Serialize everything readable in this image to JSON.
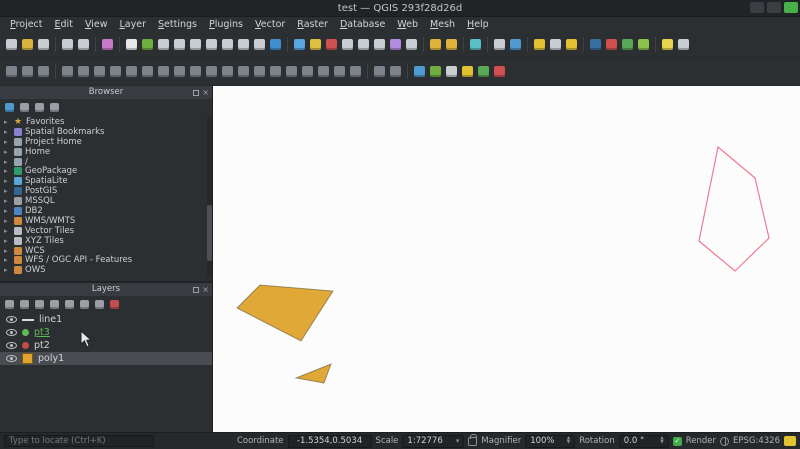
{
  "window": {
    "title": "test — QGIS 293f28d26d"
  },
  "menubar": {
    "items": [
      "Project",
      "Edit",
      "View",
      "Layer",
      "Settings",
      "Plugins",
      "Vector",
      "Raster",
      "Database",
      "Web",
      "Mesh",
      "Help"
    ]
  },
  "toolbars": {
    "row1": [
      {
        "name": "new-project-icon",
        "color": "#c9ced2"
      },
      {
        "name": "open-project-icon",
        "color": "#d9b23a"
      },
      {
        "name": "save-project-icon",
        "color": "#c9ced2"
      },
      {
        "sep": true
      },
      {
        "name": "new-print-layout-icon",
        "color": "#c9ced2"
      },
      {
        "name": "layout-manager-icon",
        "color": "#c9ced2"
      },
      {
        "sep": true
      },
      {
        "name": "style-manager-icon",
        "color": "#c879c8"
      },
      {
        "sep": true
      },
      {
        "name": "pan-map-icon",
        "color": "#e8e8e8"
      },
      {
        "name": "pan-to-selection-icon",
        "color": "#6fae3f"
      },
      {
        "name": "zoom-in-icon",
        "color": "#c9ced2"
      },
      {
        "name": "zoom-out-icon",
        "color": "#c9ced2"
      },
      {
        "name": "zoom-full-icon",
        "color": "#c9ced2"
      },
      {
        "name": "zoom-to-selection-icon",
        "color": "#c9ced2"
      },
      {
        "name": "zoom-to-layer-icon",
        "color": "#c9ced2"
      },
      {
        "name": "zoom-last-icon",
        "color": "#c9ced2"
      },
      {
        "name": "zoom-next-icon",
        "color": "#c9ced2"
      },
      {
        "name": "map-refresh-icon",
        "color": "#3f8fd0"
      },
      {
        "sep": true
      },
      {
        "name": "identify-features-icon",
        "color": "#5aa7e0"
      },
      {
        "name": "select-features-icon",
        "color": "#e0c040"
      },
      {
        "name": "deselect-features-icon",
        "color": "#d05050"
      },
      {
        "name": "select-by-expression-icon",
        "color": "#c9ced2"
      },
      {
        "name": "attribute-table-icon",
        "color": "#c9ced2"
      },
      {
        "name": "field-calculator-icon",
        "color": "#c9ced2"
      },
      {
        "name": "measure-line-icon",
        "color": "#b08be0"
      },
      {
        "name": "statistical-summary-icon",
        "color": "#c9ced2"
      },
      {
        "sep": true
      },
      {
        "name": "new-bookmark-icon",
        "color": "#e0b43c"
      },
      {
        "name": "show-bookmarks-icon",
        "color": "#e0b43c"
      },
      {
        "sep": true
      },
      {
        "name": "temporal-controller-icon",
        "color": "#58c0c8"
      },
      {
        "sep": true
      },
      {
        "name": "new-3d-map-icon",
        "color": "#c9ced2"
      },
      {
        "name": "data-source-manager-icon",
        "color": "#4f9ad0"
      },
      {
        "sep": true
      },
      {
        "name": "toggle-editing-icon",
        "color": "#e2c231"
      },
      {
        "name": "save-layer-edits-icon",
        "color": "#c9ced2"
      },
      {
        "name": "current-edits-icon",
        "color": "#e2c231"
      },
      {
        "sep": true
      },
      {
        "name": "python-console-icon",
        "color": "#3670a0"
      },
      {
        "name": "processing-toolbox-icon",
        "color": "#d05050"
      },
      {
        "name": "metasearch-icon",
        "color": "#58a858"
      },
      {
        "name": "osm-place-search-icon",
        "color": "#8bc34a"
      },
      {
        "sep": true
      },
      {
        "name": "help-icon",
        "color": "#e8d44d"
      },
      {
        "name": "whats-this-icon",
        "color": "#c9ced2"
      }
    ],
    "row2": [
      {
        "name": "enable-advanced-digitizing-icon",
        "color": "#7d838a"
      },
      {
        "name": "digitize-with-segment-icon",
        "color": "#7d838a"
      },
      {
        "name": "stream-digitizing-icon",
        "color": "#7d838a"
      },
      {
        "sep": true
      },
      {
        "name": "move-feature-icon",
        "color": "#7d838a"
      },
      {
        "name": "copy-move-feature-icon",
        "color": "#7d838a"
      },
      {
        "name": "rotate-feature-icon",
        "color": "#7d838a"
      },
      {
        "name": "simplify-feature-icon",
        "color": "#7d838a"
      },
      {
        "name": "add-ring-icon",
        "color": "#7d838a"
      },
      {
        "name": "add-part-icon",
        "color": "#7d838a"
      },
      {
        "name": "fill-ring-icon",
        "color": "#7d838a"
      },
      {
        "name": "delete-ring-icon",
        "color": "#7d838a"
      },
      {
        "name": "delete-part-icon",
        "color": "#7d838a"
      },
      {
        "name": "offset-curve-icon",
        "color": "#7d838a"
      },
      {
        "name": "reshape-features-icon",
        "color": "#7d838a"
      },
      {
        "name": "split-parts-icon",
        "color": "#7d838a"
      },
      {
        "name": "split-features-icon",
        "color": "#7d838a"
      },
      {
        "name": "merge-features-icon",
        "color": "#7d838a"
      },
      {
        "name": "merge-attributes-icon",
        "color": "#7d838a"
      },
      {
        "name": "modify-attributes-icon",
        "color": "#7d838a"
      },
      {
        "name": "rotate-point-symbols-icon",
        "color": "#7d838a"
      },
      {
        "name": "offset-point-symbol-icon",
        "color": "#7d838a"
      },
      {
        "name": "trim-extend-icon",
        "color": "#7d838a"
      },
      {
        "sep": true
      },
      {
        "name": "vertex-tool-all-layers-icon",
        "color": "#7d838a"
      },
      {
        "name": "vertex-tool-active-layer-icon",
        "color": "#7d838a"
      },
      {
        "sep": true
      },
      {
        "name": "processing-icon",
        "color": "#4f9ad0"
      },
      {
        "name": "grass-tools-icon",
        "color": "#6fae3f"
      },
      {
        "name": "raster-calculator-icon",
        "color": "#c9ced2"
      },
      {
        "name": "georeferencer-icon",
        "color": "#e2c231"
      },
      {
        "name": "mesh-calculator-icon",
        "color": "#58a858"
      },
      {
        "name": "plugin-tool-icon",
        "color": "#d05050"
      }
    ]
  },
  "browser": {
    "title": "Browser",
    "toolbar": [
      {
        "name": "refresh-browser-icon",
        "color": "#4f9ad0"
      },
      {
        "name": "filter-browser-icon",
        "color": "#9aa0a5"
      },
      {
        "name": "collapse-all-icon",
        "color": "#9aa0a5"
      },
      {
        "name": "enable-properties-icon",
        "color": "#9aa0a5"
      }
    ],
    "items": [
      {
        "label": "Favorites",
        "icon": "favorites-icon",
        "glyph": "★",
        "color": "#d4a73c"
      },
      {
        "label": "Spatial Bookmarks",
        "icon": "spatial-bookmarks-icon",
        "color": "#8a7fd0"
      },
      {
        "label": "Project Home",
        "icon": "project-home-folder-icon",
        "color": "#97a3ad"
      },
      {
        "label": "Home",
        "icon": "home-folder-icon",
        "color": "#97a3ad"
      },
      {
        "label": "/",
        "icon": "root-folder-icon",
        "color": "#97a3ad"
      },
      {
        "label": "GeoPackage",
        "icon": "geopackage-icon",
        "color": "#2e9c6b"
      },
      {
        "label": "SpatiaLite",
        "icon": "spatialite-icon",
        "color": "#55a8d8"
      },
      {
        "label": "PostGIS",
        "icon": "postgis-icon",
        "color": "#336791"
      },
      {
        "label": "MSSQL",
        "icon": "mssql-icon",
        "color": "#9aa0a5"
      },
      {
        "label": "DB2",
        "icon": "db2-icon",
        "color": "#4f84c4"
      },
      {
        "label": "WMS/WMTS",
        "icon": "wms-wmts-icon",
        "color": "#d0873e"
      },
      {
        "label": "Vector Tiles",
        "icon": "vector-tiles-icon",
        "color": "#b8bcc0"
      },
      {
        "label": "XYZ Tiles",
        "icon": "xyz-tiles-icon",
        "color": "#b8bcc0"
      },
      {
        "label": "WCS",
        "icon": "wcs-icon",
        "color": "#d0873e"
      },
      {
        "label": "WFS / OGC API - Features",
        "icon": "wfs-icon",
        "color": "#d0873e"
      },
      {
        "label": "OWS",
        "icon": "ows-icon",
        "color": "#d0873e"
      }
    ]
  },
  "layers": {
    "title": "Layers",
    "toolbar": [
      {
        "name": "open-layer-styling-icon",
        "color": "#9aa0a5"
      },
      {
        "name": "add-group-icon",
        "color": "#9aa0a5"
      },
      {
        "name": "manage-map-themes-icon",
        "color": "#9aa0a5"
      },
      {
        "name": "filter-legend-icon",
        "color": "#9aa0a5"
      },
      {
        "name": "filter-by-expression-icon",
        "color": "#9aa0a5"
      },
      {
        "name": "expand-all-icon",
        "color": "#9aa0a5"
      },
      {
        "name": "collapse-all-icon",
        "color": "#9aa0a5"
      },
      {
        "name": "remove-layer-icon",
        "color": "#c05050"
      }
    ],
    "items": [
      {
        "label": "line1",
        "type": "line",
        "symbol_color": "#d8d8d8"
      },
      {
        "label": "pt3",
        "type": "point",
        "symbol_color": "#5fb85a",
        "edited": true
      },
      {
        "label": "pt2",
        "type": "point",
        "symbol_color": "#c24f43"
      },
      {
        "label": "poly1",
        "type": "polygon",
        "symbol_color": "#e0a32e",
        "selected": true
      }
    ]
  },
  "map": {
    "background": "#fcfcfc",
    "polygon_fill": "#e0a837",
    "polygon_stroke": "#8a6a1e",
    "line_color": "#ef7a90"
  },
  "statusbar": {
    "locate_placeholder": "Type to locate (Ctrl+K)",
    "coordinate_label": "Coordinate",
    "coordinate_value": "-1.5354,0.5034",
    "scale_label": "Scale",
    "scale_value": "1:72776",
    "magnifier_label": "Magnifier",
    "magnifier_value": "100%",
    "rotation_label": "Rotation",
    "rotation_value": "0.0 °",
    "render_label": "Render",
    "crs_label": "EPSG:4326"
  }
}
